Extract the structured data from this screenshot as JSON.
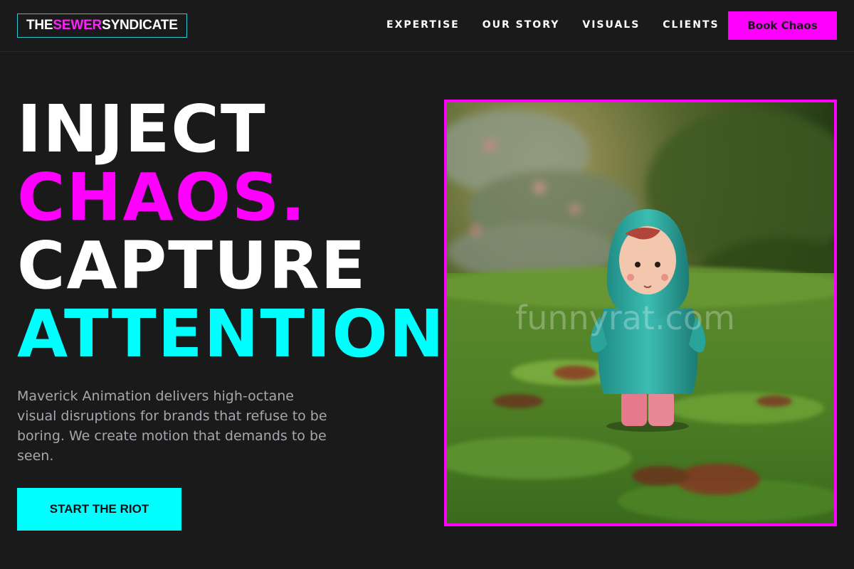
{
  "brand": {
    "prefix": "THE ",
    "highlight": "SEWER",
    "suffix": " SYNDICATE"
  },
  "nav": {
    "items": [
      "EXPERTISE",
      "OUR STORY",
      "VISUALS",
      "CLIENTS"
    ]
  },
  "header": {
    "cta_label": "Book Chaos"
  },
  "hero": {
    "line1": "INJECT",
    "line2": "CHAOS.",
    "line3": "CAPTURE",
    "line4": "ATTENTION.",
    "tagline": "Maverick Animation delivers high-octane visual disruptions for brands that refuse to be boring. We create motion that demands to be seen.",
    "cta_label": "START THE RIOT"
  },
  "image": {
    "watermark": "funnyrat.com",
    "subject": "toy figure in teal raincoat on grass"
  },
  "colors": {
    "background": "#1a1a1a",
    "magenta": "#ff00ff",
    "cyan": "#00ffff",
    "muted_text": "#a6a6ad"
  }
}
